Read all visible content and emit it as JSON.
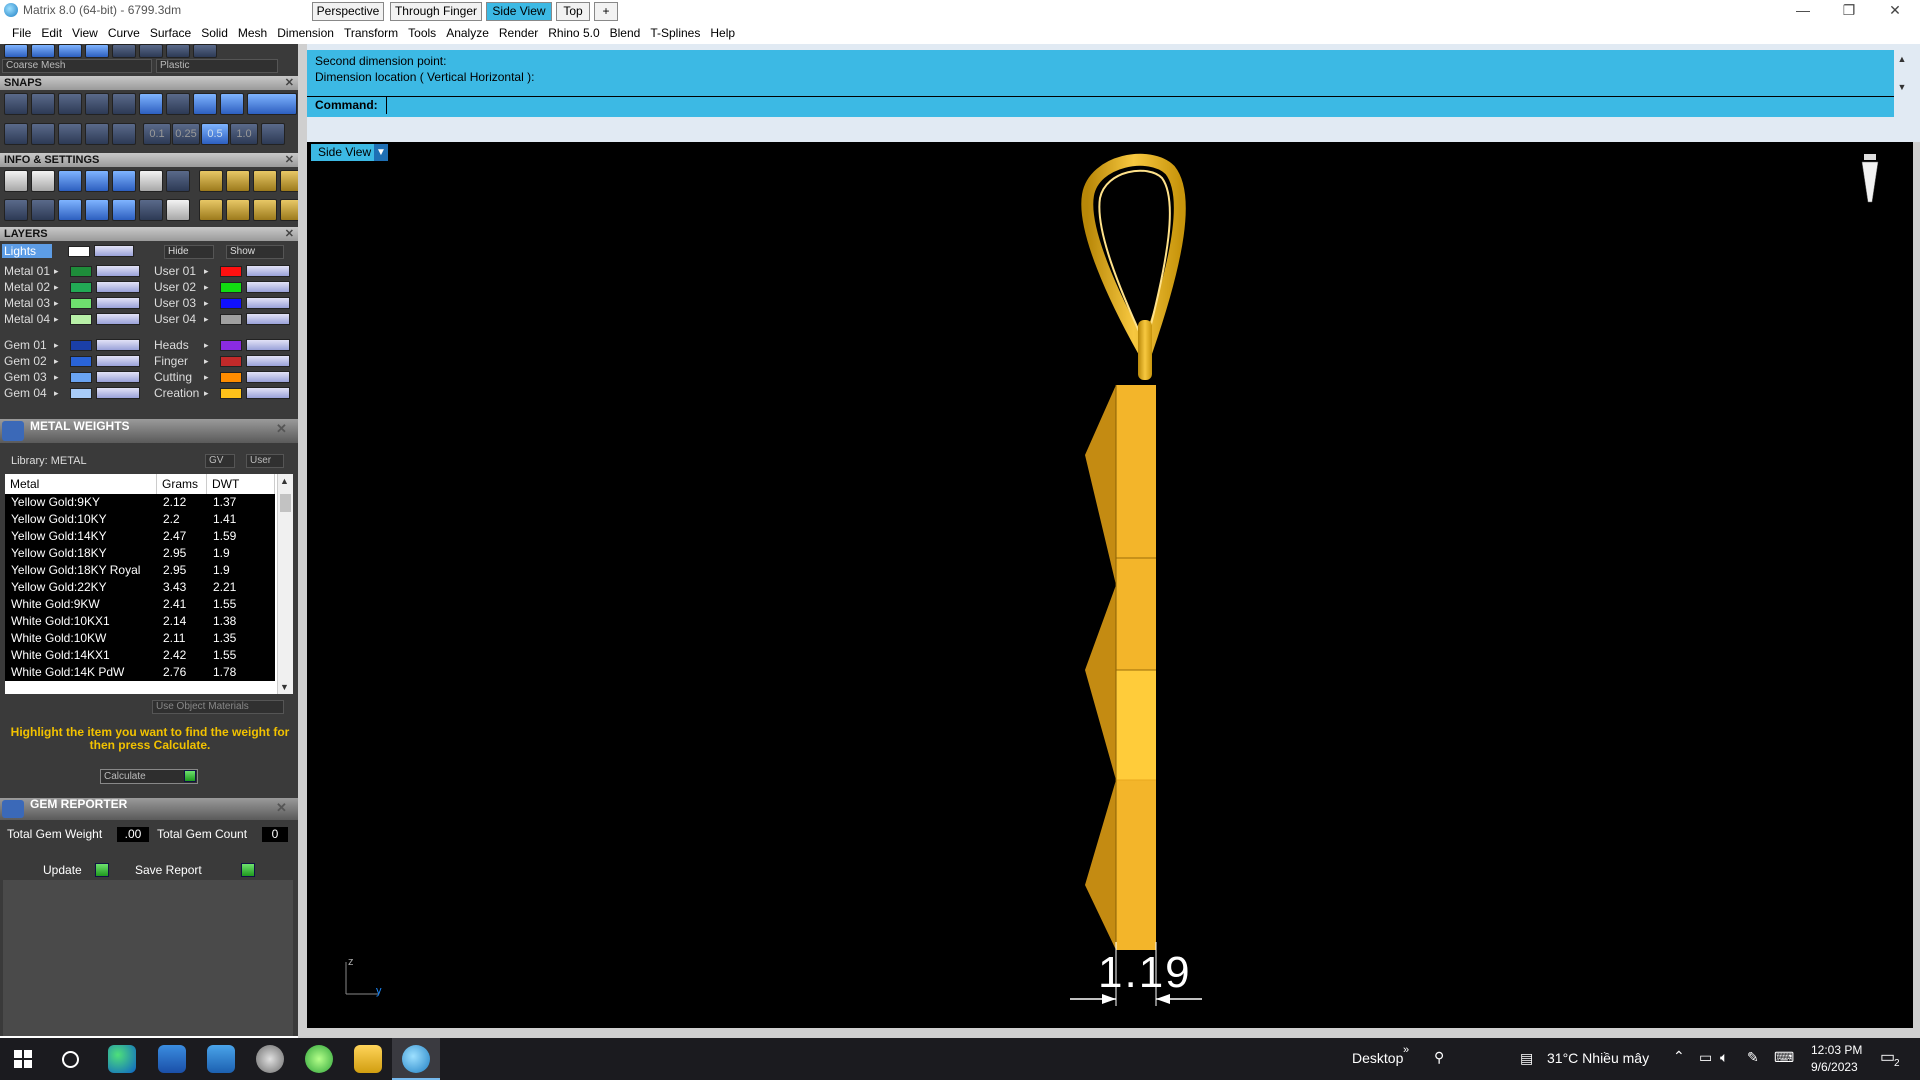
{
  "window": {
    "title": "Matrix 8.0 (64-bit) - 6799.3dm",
    "minimize": "—",
    "maximize": "❐",
    "close": "✕"
  },
  "menu": [
    "File",
    "Edit",
    "View",
    "Curve",
    "Surface",
    "Solid",
    "Mesh",
    "Dimension",
    "Transform",
    "Tools",
    "Analyze",
    "Render",
    "Rhino 5.0",
    "Blend",
    "T-Splines",
    "Help"
  ],
  "toolbar": {
    "mesh_combo": "Coarse Mesh",
    "material_combo": "Plastic"
  },
  "snaps": {
    "title": "SNAPS",
    "increments": [
      "0.1",
      "0.25",
      "0.5",
      "1.0"
    ]
  },
  "info": {
    "title": "INFO & SETTINGS"
  },
  "layers": {
    "title": "LAYERS",
    "lights": "Lights",
    "hide": "Hide",
    "show": "Show",
    "left_col": [
      {
        "name": "Metal 01",
        "color": "#1e8c3a"
      },
      {
        "name": "Metal 02",
        "color": "#22aa55"
      },
      {
        "name": "Metal 03",
        "color": "#6ee06e"
      },
      {
        "name": "Metal 04",
        "color": "#b8f0a8"
      },
      {
        "name": "Gem 01",
        "color": "#1a3fa8"
      },
      {
        "name": "Gem 02",
        "color": "#2a64d8"
      },
      {
        "name": "Gem 03",
        "color": "#6aa4f2"
      },
      {
        "name": "Gem 04",
        "color": "#a8ccf8"
      }
    ],
    "right_col": [
      {
        "name": "User 01",
        "color": "#ff1010"
      },
      {
        "name": "User 02",
        "color": "#11dd11"
      },
      {
        "name": "User 03",
        "color": "#1010ff"
      },
      {
        "name": "User 04",
        "color": "#a0a0a0"
      },
      {
        "name": "Heads",
        "color": "#8a2be2"
      },
      {
        "name": "Finger",
        "color": "#c22a2a"
      },
      {
        "name": "Cutting",
        "color": "#ff8c00"
      },
      {
        "name": "Creation",
        "color": "#ffc21a"
      }
    ]
  },
  "metal_weights": {
    "title": "METAL WEIGHTS",
    "library_label": "Library: METAL",
    "gv": "GV",
    "user": "User",
    "columns": [
      "Metal",
      "Grams",
      "DWT"
    ],
    "rows": [
      [
        "Yellow Gold:9KY",
        "2.12",
        "1.37"
      ],
      [
        "Yellow Gold:10KY",
        "2.2",
        "1.41"
      ],
      [
        "Yellow Gold:14KY",
        "2.47",
        "1.59"
      ],
      [
        "Yellow Gold:18KY",
        "2.95",
        "1.9"
      ],
      [
        "Yellow Gold:18KY Royal",
        "2.95",
        "1.9"
      ],
      [
        "Yellow Gold:22KY",
        "3.43",
        "2.21"
      ],
      [
        "White Gold:9KW",
        "2.41",
        "1.55"
      ],
      [
        "White Gold:10KX1",
        "2.14",
        "1.38"
      ],
      [
        "White Gold:10KW",
        "2.11",
        "1.35"
      ],
      [
        "White Gold:14KX1",
        "2.42",
        "1.55"
      ],
      [
        "White Gold:14K PdW",
        "2.76",
        "1.78"
      ]
    ],
    "use_object_materials": "Use Object Materials",
    "hint": "Highlight the item you want to find the weight for then press Calculate.",
    "calculate": "Calculate"
  },
  "gem_reporter": {
    "title": "GEM REPORTER",
    "total_weight_label": "Total Gem Weight",
    "total_weight": ".00",
    "total_count_label": "Total Gem Count",
    "total_count": "0",
    "update": "Update",
    "save_report": "Save Report"
  },
  "console": {
    "line1": "Second dimension point:",
    "line2": "Dimension location ( Vertical  Horizontal ):",
    "command_label": "Command:"
  },
  "viewport_tabs": [
    "Perspective",
    "Through Finger",
    "Side View",
    "Top",
    "+"
  ],
  "active_tab": "Side View",
  "viewport": {
    "label": "Side View",
    "dimension": "1.19",
    "axis_z": "z",
    "axis_y": "y"
  },
  "taskbar": {
    "desktop": "Desktop",
    "weather": "31°C  Nhiều mây",
    "time": "12:03 PM",
    "date": "9/6/2023",
    "notifications": "2"
  },
  "colors": {
    "console": "#3cb9e4",
    "panel": "#3a3a3a",
    "gold": "#f5b82a",
    "hint": "#f2c200"
  }
}
